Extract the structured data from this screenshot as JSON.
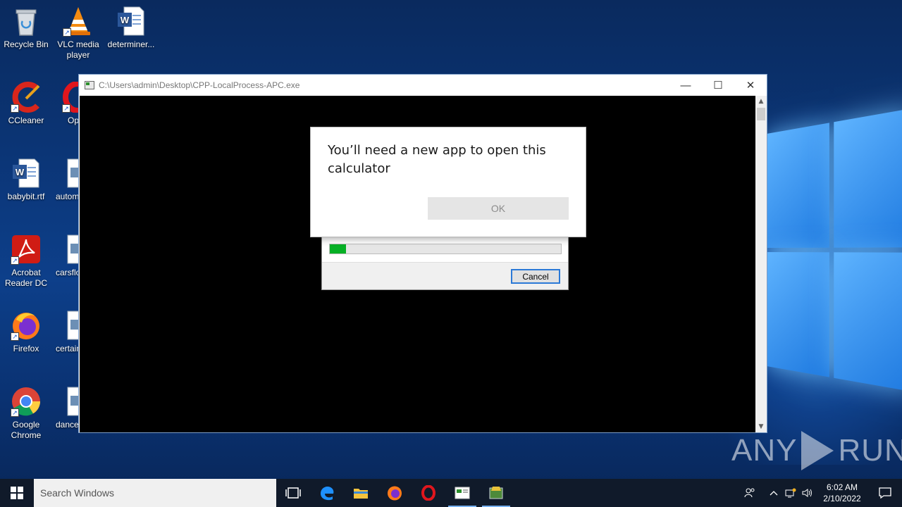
{
  "desktop": {
    "icons": [
      {
        "label": "Recycle Bin",
        "icon": "recycle-bin-icon"
      },
      {
        "label": "VLC media player",
        "icon": "vlc-icon"
      },
      {
        "label": "determiner...",
        "icon": "word-doc-icon"
      },
      {
        "label": "CCleaner",
        "icon": "ccleaner-icon"
      },
      {
        "label": "Op",
        "icon": "opera-icon"
      },
      {
        "label": "babybit.rtf",
        "icon": "word-doc-icon"
      },
      {
        "label": "autom",
        "icon": "image-file-icon"
      },
      {
        "label": "Acrobat Reader DC",
        "icon": "acrobat-icon"
      },
      {
        "label": "carsflo",
        "icon": "image-file-icon"
      },
      {
        "label": "Firefox",
        "icon": "firefox-icon"
      },
      {
        "label": "certain",
        "icon": "image-file-icon"
      },
      {
        "label": "Google Chrome",
        "icon": "chrome-icon"
      },
      {
        "label": "dance",
        "icon": "image-file-icon"
      }
    ]
  },
  "console_window": {
    "title": "C:\\Users\\admin\\Desktop\\CPP-LocalProcess-APC.exe",
    "minimize_glyph": "—",
    "maximize_glyph": "☐",
    "close_glyph": "✕"
  },
  "message_dialog": {
    "message": "You’ll need a new app to open this calculator",
    "ok_label": "OK"
  },
  "progress_dialog": {
    "progress_percent": 7,
    "cancel_label": "Cancel"
  },
  "watermark": {
    "left": "ANY",
    "right": "RUN"
  },
  "taskbar": {
    "search_placeholder": "Search Windows",
    "apps": [
      "task-view",
      "edge",
      "file-explorer",
      "firefox",
      "opera",
      "console",
      "installer"
    ],
    "clock_time": "6:02 AM",
    "clock_date": "2/10/2022"
  },
  "colors": {
    "progress_fill": "#06b025",
    "cancel_border": "#2b79d7",
    "taskbar_bg": "#101a2a"
  }
}
